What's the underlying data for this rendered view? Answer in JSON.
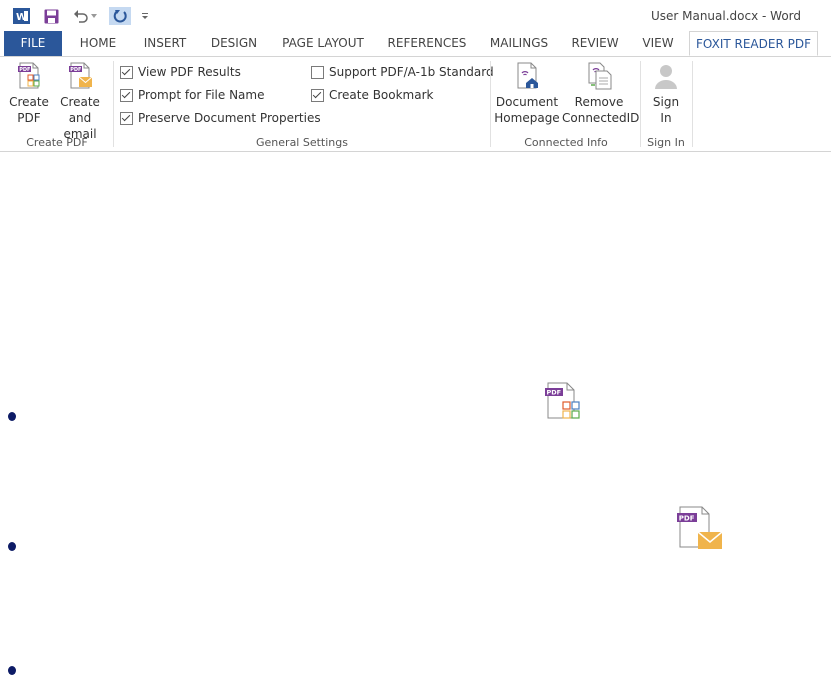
{
  "title_bar": {
    "title": "User Manual.docx - Word",
    "qat": [
      "word-icon",
      "save-icon",
      "undo-icon",
      "undo-dropdown-icon",
      "repeat-icon",
      "customize-qat-icon"
    ]
  },
  "tabs": [
    "FILE",
    "HOME",
    "INSERT",
    "DESIGN",
    "PAGE LAYOUT",
    "REFERENCES",
    "MAILINGS",
    "REVIEW",
    "VIEW",
    "FOXIT READER PDF"
  ],
  "active_tab": "FOXIT READER PDF",
  "ribbon": {
    "create_pdf": {
      "label": "Create PDF",
      "create_pdf_btn": "Create\nPDF",
      "create_email_btn": "Create\nand email"
    },
    "general_settings": {
      "label": "General Settings",
      "options": [
        {
          "text": "View PDF Results",
          "checked": true
        },
        {
          "text": "Prompt for File Name",
          "checked": true
        },
        {
          "text": "Preserve Document Properties",
          "checked": true
        },
        {
          "text": "Support PDF/A-1b Standard",
          "checked": false
        },
        {
          "text": "Create Bookmark",
          "checked": true
        }
      ]
    },
    "connected_info": {
      "label": "Connected Info",
      "doc_homepage_btn": "Document\nHomepage",
      "remove_id_btn": "Remove\nConnectedID"
    },
    "sign_in": {
      "label": "Sign In",
      "btn": "Sign\nIn"
    }
  },
  "colors": {
    "file_tab": "#2b579a",
    "pdf_badge": "#7b3e98",
    "bullet": "#0d1b66",
    "mail": "#f0b44c"
  }
}
